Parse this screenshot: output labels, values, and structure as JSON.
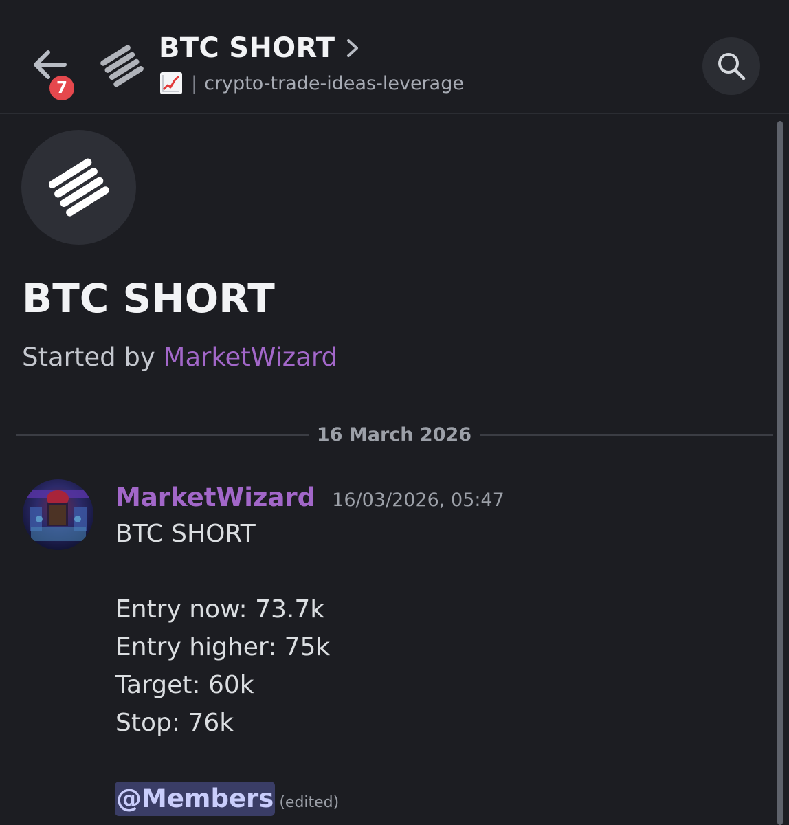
{
  "header": {
    "unread_count": "7",
    "title": "BTC SHORT",
    "channel_name": "crypto-trade-ideas-leverage",
    "separator": "|",
    "icons": {
      "back": "arrow-left-icon",
      "forum": "forum-stripes-icon",
      "chevron": "chevron-right-icon",
      "channel_emoji": "chart-increasing-emoji",
      "search": "search-icon"
    }
  },
  "thread": {
    "title": "BTC SHORT",
    "started_by_prefix": "Started by",
    "author": "MarketWizard"
  },
  "divider": {
    "date": "16 March 2026"
  },
  "message": {
    "author": "MarketWizard",
    "timestamp": "16/03/2026, 05:47",
    "lines": [
      "BTC SHORT",
      "Entry now: 73.7k",
      "Entry higher: 75k",
      "Target: 60k",
      "Stop: 76k"
    ],
    "mention": "@Members",
    "edited": "(edited)"
  },
  "colors": {
    "background": "#1c1d22",
    "author_purple": "#a267c9",
    "badge_red": "#e5484d",
    "mention_bg": "#3a3d66",
    "mention_text": "#c9cdfb"
  }
}
